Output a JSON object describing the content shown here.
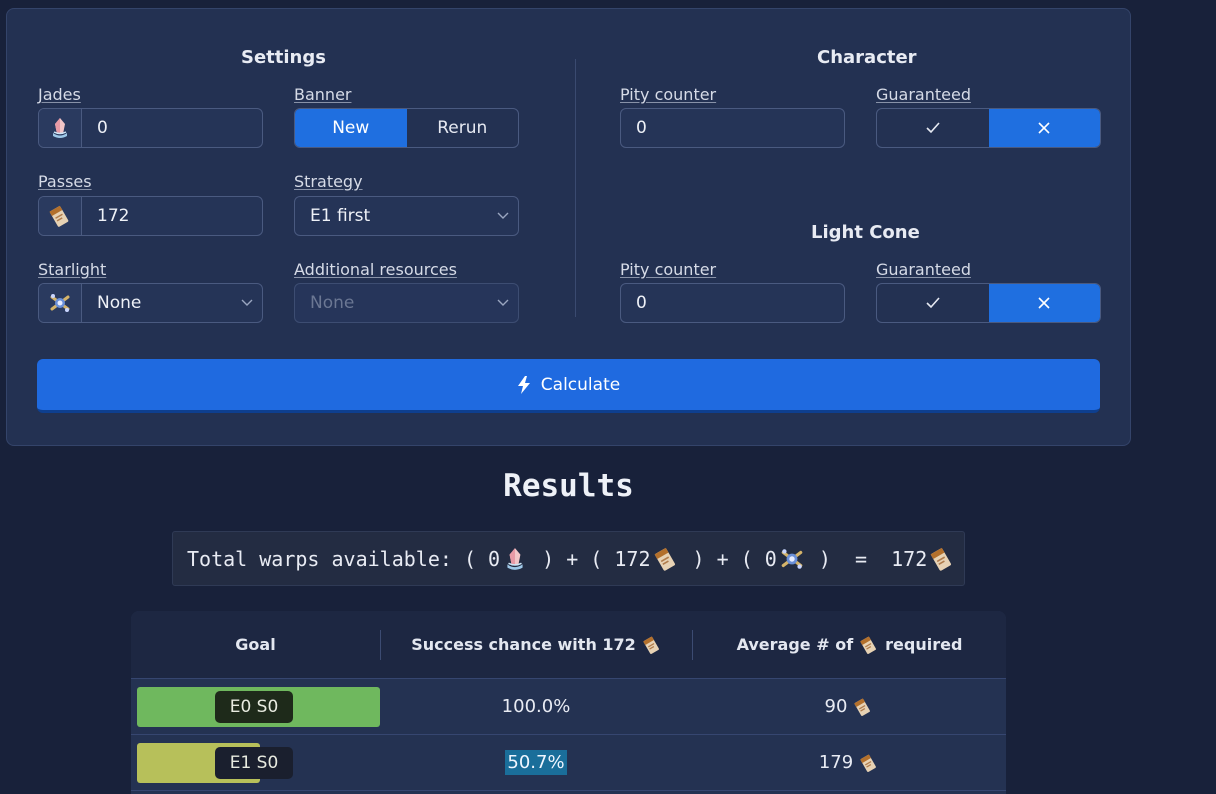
{
  "settings": {
    "title": "Settings",
    "jades": {
      "label": "Jades",
      "value": "0"
    },
    "banner": {
      "label": "Banner",
      "options": [
        "New",
        "Rerun"
      ],
      "selected": "New"
    },
    "passes": {
      "label": "Passes",
      "value": "172"
    },
    "strategy": {
      "label": "Strategy",
      "value": "E1 first"
    },
    "starlight": {
      "label": "Starlight",
      "value": "None"
    },
    "additional": {
      "label": "Additional resources",
      "value": "None"
    }
  },
  "character": {
    "title": "Character",
    "pity_label": "Pity counter",
    "pity_value": "0",
    "guaranteed_label": "Guaranteed",
    "guaranteed": false
  },
  "light_cone": {
    "title": "Light Cone",
    "pity_label": "Pity counter",
    "pity_value": "0",
    "guaranteed_label": "Guaranteed",
    "guaranteed": false
  },
  "calculate_label": "Calculate",
  "results": {
    "title": "Results",
    "total_prefix": "Total warps available:",
    "jades": "0",
    "passes": "172",
    "starlight": "0",
    "total": "172",
    "headers": {
      "goal": "Goal",
      "success": "Success chance with 172",
      "average_pre": "Average # of",
      "average_post": "required"
    },
    "rows": [
      {
        "goal": "E0 S0",
        "chance": "100.0%",
        "chance_value": 1.0,
        "avg": "90",
        "bar_color": "#6fb85e"
      },
      {
        "goal": "E1 S0",
        "chance": "50.7%",
        "chance_value": 0.507,
        "avg": "179",
        "bar_color": "#b7c05a"
      }
    ]
  },
  "colors": {
    "accent": "#1f6ae0",
    "panel": "#233152",
    "background": "#18213a"
  },
  "icons": {
    "jade": "jade-crystal-icon",
    "pass": "star-rail-pass-icon",
    "starlight": "starlight-icon",
    "chevron": "chevron-down-icon",
    "bolt": "lightning-bolt-icon",
    "check": "check-icon",
    "cross": "close-icon"
  }
}
